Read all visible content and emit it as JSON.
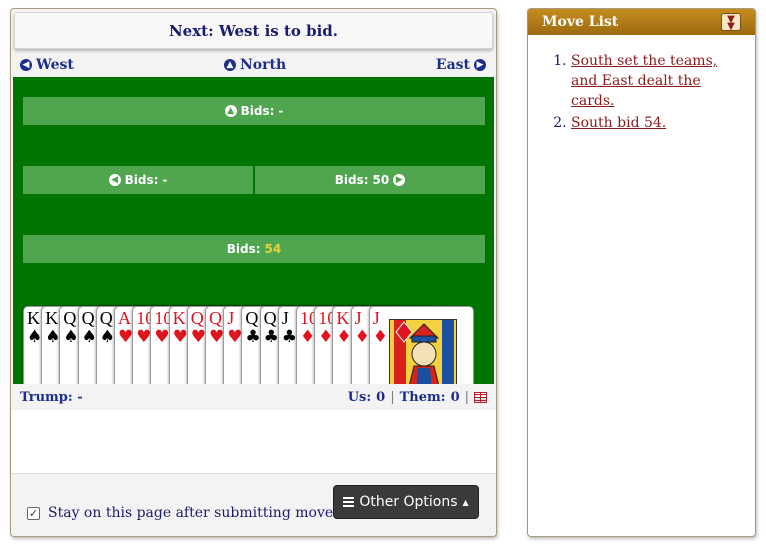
{
  "status": {
    "text": "Next: West is to bid."
  },
  "compass": {
    "west": "West",
    "north": "North",
    "east": "East"
  },
  "bids": {
    "north": {
      "label": "Bids:",
      "value": "-"
    },
    "west": {
      "label": "Bids:",
      "value": "-"
    },
    "east": {
      "label": "Bids:",
      "value": "50"
    },
    "south": {
      "label": "Bids:",
      "value": "54"
    }
  },
  "hand": [
    {
      "rank": "K",
      "suit": "♠",
      "color": "black"
    },
    {
      "rank": "K",
      "suit": "♠",
      "color": "black"
    },
    {
      "rank": "Q",
      "suit": "♠",
      "color": "black"
    },
    {
      "rank": "Q",
      "suit": "♠",
      "color": "black"
    },
    {
      "rank": "Q",
      "suit": "♠",
      "color": "black"
    },
    {
      "rank": "A",
      "suit": "♥",
      "color": "red"
    },
    {
      "rank": "10",
      "suit": "♥",
      "color": "red"
    },
    {
      "rank": "10",
      "suit": "♥",
      "color": "red"
    },
    {
      "rank": "K",
      "suit": "♥",
      "color": "red"
    },
    {
      "rank": "Q",
      "suit": "♥",
      "color": "red"
    },
    {
      "rank": "Q",
      "suit": "♥",
      "color": "red"
    },
    {
      "rank": "J",
      "suit": "♥",
      "color": "red"
    },
    {
      "rank": "Q",
      "suit": "♣",
      "color": "black"
    },
    {
      "rank": "Q",
      "suit": "♣",
      "color": "black"
    },
    {
      "rank": "J",
      "suit": "♣",
      "color": "black"
    },
    {
      "rank": "10",
      "suit": "♦",
      "color": "red"
    },
    {
      "rank": "10",
      "suit": "♦",
      "color": "red"
    },
    {
      "rank": "K",
      "suit": "♦",
      "color": "red"
    },
    {
      "rank": "J",
      "suit": "♦",
      "color": "red"
    },
    {
      "rank": "J",
      "suit": "♦",
      "color": "red"
    }
  ],
  "info": {
    "trump_label": "Trump:",
    "trump_value": "-",
    "us_label": "Us:",
    "us_value": "0",
    "separator": "|",
    "them_label": "Them:",
    "them_value": "0"
  },
  "footer": {
    "stay_label": "Stay on this page after submitting move.",
    "stay_checked": true,
    "options_label": "Other Options"
  },
  "move_list": {
    "title": "Move List",
    "items": [
      "South set the teams, and East dealt the cards.",
      "South bid 54."
    ]
  },
  "colors": {
    "felt": "#007400",
    "bid_bar": "#4fa64f",
    "highlight_bid": "#e8d23c",
    "header_gold": "#b07c18",
    "link": "#8b1a1a",
    "navy": "#1c2d8a"
  }
}
